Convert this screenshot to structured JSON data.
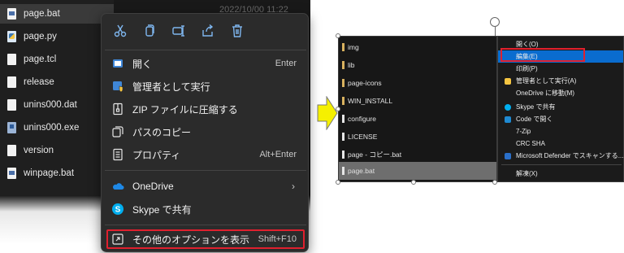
{
  "left": {
    "date_text": "2022/10/00 11:22",
    "files": [
      {
        "name": "page.bat",
        "icon": "bat-file-icon",
        "selected": true
      },
      {
        "name": "page.py",
        "icon": "python-file-icon"
      },
      {
        "name": "page.tcl",
        "icon": "document-icon"
      },
      {
        "name": "release",
        "icon": "document-icon"
      },
      {
        "name": "unins000.dat",
        "icon": "document-icon"
      },
      {
        "name": "unins000.exe",
        "icon": "exe-file-icon"
      },
      {
        "name": "version",
        "icon": "document-icon"
      },
      {
        "name": "winpage.bat",
        "icon": "bat-file-icon"
      }
    ]
  },
  "context_menu": {
    "quick_actions": [
      "cut-icon",
      "copy-icon",
      "rename-icon",
      "share-icon",
      "delete-icon"
    ],
    "items": [
      {
        "label": "開く",
        "shortcut": "Enter",
        "icon": "open-icon"
      },
      {
        "label": "管理者として実行",
        "shortcut": "",
        "icon": "shield-icon"
      },
      {
        "label": "ZIP ファイルに圧縮する",
        "shortcut": "",
        "icon": "zip-icon"
      },
      {
        "label": "パスのコピー",
        "shortcut": "",
        "icon": "copy-path-icon"
      },
      {
        "label": "プロパティ",
        "shortcut": "Alt+Enter",
        "icon": "properties-icon"
      },
      {
        "label": "OneDrive",
        "shortcut": "",
        "icon": "onedrive-icon",
        "submenu": true
      },
      {
        "label": "Skype で共有",
        "shortcut": "",
        "icon": "skype-icon"
      },
      {
        "label": "その他のオプションを表示",
        "shortcut": "Shift+F10",
        "icon": "more-options-icon"
      }
    ]
  },
  "right_panel": {
    "items": [
      {
        "name": "img",
        "type": "folder"
      },
      {
        "name": "lib",
        "type": "folder"
      },
      {
        "name": "page-icons",
        "type": "folder"
      },
      {
        "name": "WIN_INSTALL",
        "type": "folder"
      },
      {
        "name": "configure",
        "type": "file"
      },
      {
        "name": "LICENSE",
        "type": "file"
      },
      {
        "name": "page - コピー.bat",
        "type": "file"
      },
      {
        "name": "page.bat",
        "type": "file",
        "selected": true
      }
    ]
  },
  "classic_menu": {
    "items": [
      {
        "label": "開く(O)",
        "icon": ""
      },
      {
        "label": "編集(E)",
        "icon": "",
        "highlighted": true
      },
      {
        "label": "印刷(P)",
        "icon": ""
      },
      {
        "label": "管理者として実行(A)",
        "icon": "shield-icon"
      },
      {
        "label": "OneDrive に移動(M)",
        "icon": ""
      },
      {
        "label": "Skype で共有",
        "icon": "skype-icon"
      },
      {
        "label": "Code で開く",
        "icon": "vscode-icon"
      },
      {
        "label": "7-Zip",
        "icon": ""
      },
      {
        "label": "CRC SHA",
        "icon": ""
      },
      {
        "label": "Microsoft Defender でスキャンする...",
        "icon": "defender-icon"
      },
      {
        "label": "解凍(X)",
        "icon": ""
      }
    ]
  },
  "colors": {
    "accent": "#7fb7f0",
    "highlight_red": "#e0202e",
    "menu_bg": "#2b2b2b",
    "selection_blue": "#0a6ccf",
    "arrow_yellow": "#f5f000"
  }
}
